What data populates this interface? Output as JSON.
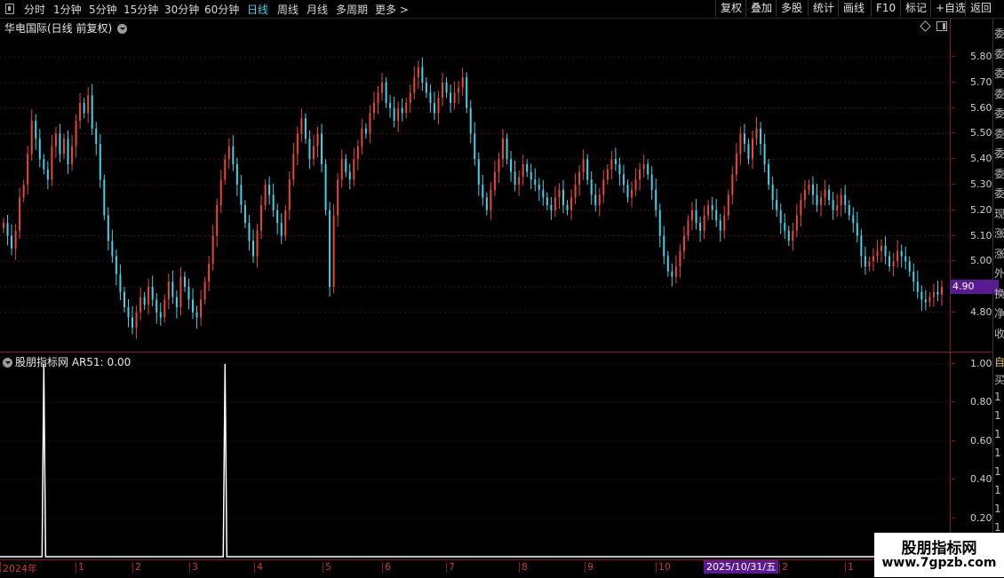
{
  "toolbar": {
    "periods": [
      {
        "label": "分时",
        "active": false
      },
      {
        "label": "1分钟",
        "active": false
      },
      {
        "label": "5分钟",
        "active": false
      },
      {
        "label": "15分钟",
        "active": false
      },
      {
        "label": "30分钟",
        "active": false
      },
      {
        "label": "60分钟",
        "active": false
      },
      {
        "label": "日线",
        "active": true
      },
      {
        "label": "周线",
        "active": false
      },
      {
        "label": "月线",
        "active": false
      },
      {
        "label": "多周期",
        "active": false
      },
      {
        "label": "更多 >",
        "active": false
      }
    ],
    "actions": [
      "复权",
      "叠加",
      "多股",
      "统计",
      "画线",
      "F10",
      "标记",
      "+自选",
      "返回"
    ]
  },
  "main_chart": {
    "title": "华电国际(日线 前复权)",
    "last_price": "4.90",
    "price_ticks": [
      "5.80",
      "5.70",
      "5.60",
      "5.50",
      "5.40",
      "5.30",
      "5.20",
      "5.10",
      "5.00",
      "4.90",
      "4.80"
    ]
  },
  "indicator": {
    "title": "股朋指标网",
    "value_label": "AR51: 0.00",
    "ticks": [
      "1.00",
      "0.80",
      "0.60",
      "0.40",
      "0.20"
    ]
  },
  "date_axis": {
    "labels": [
      "2024年",
      "1",
      "2",
      "3",
      "4",
      "5",
      "6",
      "7",
      "8",
      "9",
      "10",
      "2",
      "1"
    ],
    "cursor_date": "2025/10/31/五"
  },
  "right_strip": {
    "chars": [
      "委",
      "委",
      "委",
      "委",
      "委",
      "委",
      "委",
      "委",
      "委",
      "现",
      "涨",
      "涨",
      "外",
      "换",
      "净",
      "收"
    ],
    "gold_char": "自",
    "lower_chars": [
      "买",
      "1",
      "1",
      "1",
      "1",
      "1",
      "1",
      "1",
      "1",
      "1"
    ]
  },
  "watermark": {
    "title": "股朋指标网",
    "url": "www.7gpzb.com"
  },
  "colors": {
    "up": "#e8473a",
    "down": "#3fd3e8",
    "axis": "#8a1a1a",
    "grid": "#4a0d0d",
    "active_period": "#3fd3e8",
    "highlight": "#5a1a96"
  },
  "chart_data": [
    {
      "type": "candlestick",
      "title": "华电国际(日线 前复权)",
      "ylim": [
        4.65,
        5.95
      ],
      "y_ticks": [
        5.8,
        5.7,
        5.6,
        5.5,
        5.4,
        5.3,
        5.2,
        5.1,
        5.0,
        4.9,
        4.8
      ],
      "closes": [
        5.15,
        5.1,
        5.05,
        5.12,
        5.25,
        5.3,
        5.42,
        5.55,
        5.48,
        5.4,
        5.36,
        5.32,
        5.45,
        5.5,
        5.42,
        5.48,
        5.38,
        5.45,
        5.55,
        5.62,
        5.58,
        5.65,
        5.52,
        5.46,
        5.32,
        5.18,
        5.08,
        5.02,
        4.95,
        4.88,
        4.82,
        4.78,
        4.74,
        4.8,
        4.86,
        4.83,
        4.9,
        4.85,
        4.8,
        4.78,
        4.85,
        4.92,
        4.86,
        4.82,
        4.94,
        4.9,
        4.85,
        4.8,
        4.78,
        4.85,
        4.92,
        4.99,
        5.1,
        5.22,
        5.32,
        5.4,
        5.45,
        5.38,
        5.3,
        5.22,
        5.15,
        5.08,
        5.02,
        5.12,
        5.22,
        5.3,
        5.26,
        5.2,
        5.15,
        5.1,
        5.2,
        5.32,
        5.42,
        5.5,
        5.56,
        5.48,
        5.4,
        5.45,
        5.5,
        5.38,
        5.2,
        4.9,
        5.18,
        5.32,
        5.4,
        5.35,
        5.32,
        5.4,
        5.45,
        5.52,
        5.5,
        5.58,
        5.62,
        5.66,
        5.7,
        5.62,
        5.6,
        5.55,
        5.6,
        5.58,
        5.62,
        5.66,
        5.72,
        5.76,
        5.7,
        5.66,
        5.62,
        5.58,
        5.64,
        5.7,
        5.66,
        5.62,
        5.66,
        5.68,
        5.72,
        5.6,
        5.5,
        5.4,
        5.3,
        5.25,
        5.2,
        5.28,
        5.35,
        5.4,
        5.48,
        5.4,
        5.35,
        5.3,
        5.33,
        5.38,
        5.35,
        5.32,
        5.3,
        5.28,
        5.25,
        5.22,
        5.2,
        5.25,
        5.28,
        5.22,
        5.2,
        5.25,
        5.3,
        5.35,
        5.4,
        5.32,
        5.26,
        5.22,
        5.26,
        5.32,
        5.36,
        5.4,
        5.38,
        5.34,
        5.3,
        5.25,
        5.28,
        5.32,
        5.36,
        5.38,
        5.34,
        5.28,
        5.2,
        5.1,
        5.02,
        4.96,
        4.94,
        4.98,
        5.04,
        5.1,
        5.16,
        5.2,
        5.15,
        5.12,
        5.18,
        5.22,
        5.2,
        5.16,
        5.12,
        5.18,
        5.26,
        5.34,
        5.42,
        5.5,
        5.46,
        5.4,
        5.48,
        5.52,
        5.46,
        5.38,
        5.3,
        5.24,
        5.2,
        5.15,
        5.12,
        5.08,
        5.12,
        5.18,
        5.24,
        5.28,
        5.3,
        5.26,
        5.22,
        5.25,
        5.28,
        5.24,
        5.2,
        5.22,
        5.26,
        5.22,
        5.18,
        5.15,
        5.1,
        5.02,
        4.98,
        5.0,
        5.02,
        5.04,
        5.06,
        5.02,
        4.98,
        5.0,
        5.04,
        5.02,
        5.0,
        4.96,
        4.92,
        4.88,
        4.85,
        4.84,
        4.86,
        4.88,
        4.87,
        4.9
      ]
    },
    {
      "type": "line",
      "series": [
        {
          "name": "AR51",
          "spikes": [
            {
              "bar": 10,
              "value": 1.0
            },
            {
              "bar": 55,
              "value": 1.0
            }
          ],
          "baseline": 0.0
        }
      ],
      "ylim": [
        0,
        1.05
      ],
      "y_ticks": [
        1.0,
        0.8,
        0.6,
        0.4,
        0.2
      ]
    }
  ]
}
